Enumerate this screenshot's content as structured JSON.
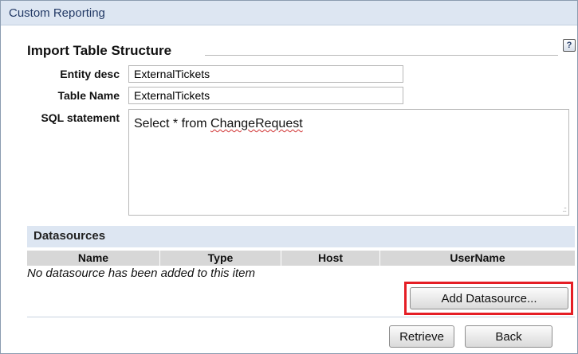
{
  "window": {
    "title": "Custom Reporting"
  },
  "form": {
    "section_title": "Import Table Structure",
    "help_icon_glyph": "?",
    "entity_desc": {
      "label": "Entity desc",
      "value": "ExternalTickets"
    },
    "table_name": {
      "label": "Table Name",
      "value": "ExternalTickets"
    },
    "sql_statement": {
      "label": "SQL statement",
      "value_prefix": "Select * from ",
      "value_misspelled": "ChangeRequest"
    }
  },
  "datasources": {
    "header": "Datasources",
    "columns": [
      "Name",
      "Type",
      "Host",
      "UserName"
    ],
    "empty_message": "No datasource has been added to this item",
    "add_button": "Add Datasource..."
  },
  "actions": {
    "retrieve_label": "Retrieve",
    "back_label": "Back"
  },
  "colors": {
    "header_band": "#dde6f2",
    "title_text": "#233a66",
    "column_header": "#d7d7d7",
    "highlight_box": "#e51e25"
  }
}
